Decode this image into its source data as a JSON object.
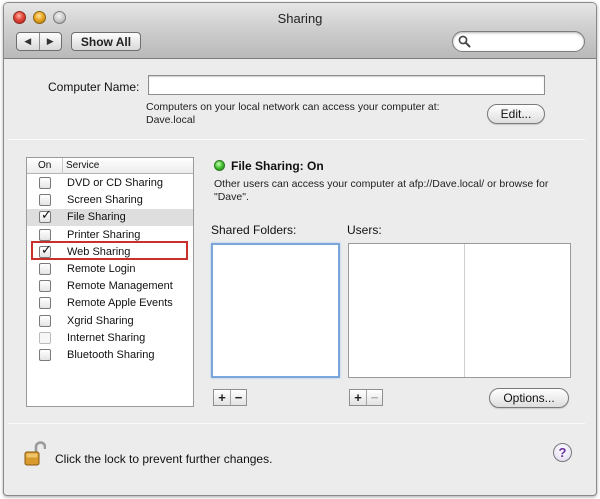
{
  "window": {
    "title": "Sharing"
  },
  "toolbar": {
    "back_glyph": "◀",
    "forward_glyph": "▶",
    "show_all_label": "Show All",
    "search_value": "",
    "search_placeholder": ""
  },
  "computer_name": {
    "label": "Computer Name:",
    "value": "",
    "access_text": "Computers on your local network can access your computer at:",
    "address": "Dave.local",
    "edit_label": "Edit..."
  },
  "services": {
    "header_on": "On",
    "header_service": "Service",
    "items": [
      {
        "name": "DVD or CD Sharing",
        "checked": false,
        "enabled": true
      },
      {
        "name": "Screen Sharing",
        "checked": false,
        "enabled": true
      },
      {
        "name": "File Sharing",
        "checked": true,
        "enabled": true,
        "selected": true
      },
      {
        "name": "Printer Sharing",
        "checked": false,
        "enabled": true
      },
      {
        "name": "Web Sharing",
        "checked": true,
        "enabled": true,
        "highlighted": true
      },
      {
        "name": "Remote Login",
        "checked": false,
        "enabled": true
      },
      {
        "name": "Remote Management",
        "checked": false,
        "enabled": true
      },
      {
        "name": "Remote Apple Events",
        "checked": false,
        "enabled": true
      },
      {
        "name": "Xgrid Sharing",
        "checked": false,
        "enabled": true
      },
      {
        "name": "Internet Sharing",
        "checked": false,
        "enabled": false
      },
      {
        "name": "Bluetooth Sharing",
        "checked": false,
        "enabled": true
      }
    ]
  },
  "detail": {
    "status": "File Sharing: On",
    "description": "Other users can access your computer at afp://Dave.local/ or browse for \"Dave\".",
    "shared_folders_label": "Shared Folders:",
    "users_label": "Users:",
    "add_glyph": "+",
    "remove_glyph": "−",
    "options_label": "Options..."
  },
  "footer": {
    "lock_text": "Click the lock to prevent further changes.",
    "help_glyph": "?"
  },
  "colors": {
    "status_on": "#3fbf2d",
    "highlight_box": "#c9302c",
    "focus_ring": "#7aa6da",
    "help": "#6a2fa0"
  }
}
